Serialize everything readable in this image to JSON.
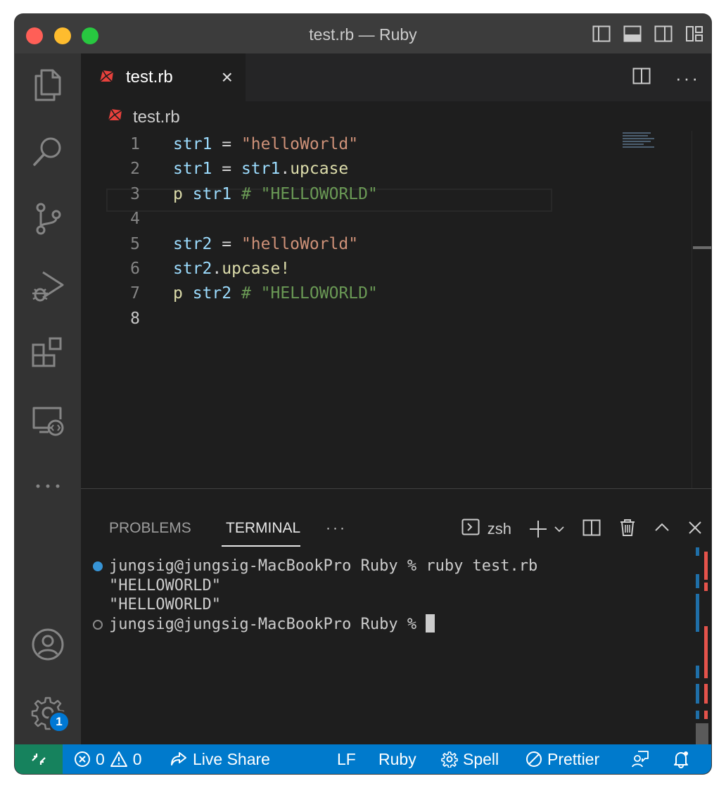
{
  "window": {
    "title": "test.rb — Ruby"
  },
  "activity_bar": {
    "icons": [
      "files-icon",
      "search-icon",
      "source-control-icon",
      "run-debug-icon",
      "extensions-icon",
      "remote-explorer-icon",
      "more-icon",
      "account-icon",
      "settings-gear-icon"
    ],
    "settings_badge": "1"
  },
  "editor": {
    "tab": {
      "label": "test.rb",
      "close": "×"
    },
    "more_actions": "···",
    "breadcrumb": "test.rb",
    "lines": [
      {
        "n": "1",
        "tokens": [
          [
            "v",
            "str1"
          ],
          [
            "o",
            " = "
          ],
          [
            "s",
            "\"helloWorld\""
          ]
        ]
      },
      {
        "n": "2",
        "tokens": [
          [
            "v",
            "str1"
          ],
          [
            "o",
            " = "
          ],
          [
            "v",
            "str1"
          ],
          [
            "o",
            "."
          ],
          [
            "f",
            "upcase"
          ]
        ]
      },
      {
        "n": "3",
        "tokens": [
          [
            "f",
            "p"
          ],
          [
            "o",
            " "
          ],
          [
            "v",
            "str1"
          ],
          [
            "o",
            " "
          ],
          [
            "c",
            "# \"HELLOWORLD\""
          ]
        ]
      },
      {
        "n": "4",
        "tokens": []
      },
      {
        "n": "5",
        "tokens": [
          [
            "v",
            "str2"
          ],
          [
            "o",
            " = "
          ],
          [
            "s",
            "\"helloWorld\""
          ]
        ]
      },
      {
        "n": "6",
        "tokens": [
          [
            "v",
            "str2"
          ],
          [
            "o",
            "."
          ],
          [
            "f",
            "upcase!"
          ]
        ]
      },
      {
        "n": "7",
        "tokens": [
          [
            "f",
            "p"
          ],
          [
            "o",
            " "
          ],
          [
            "v",
            "str2"
          ],
          [
            "o",
            " "
          ],
          [
            "c",
            "# \"HELLOWORLD\""
          ]
        ]
      },
      {
        "n": "8",
        "tokens": []
      }
    ],
    "active_line": "8"
  },
  "panel": {
    "tabs": [
      "PROBLEMS",
      "TERMINAL"
    ],
    "active_tab": "TERMINAL",
    "more": "···",
    "shell": "zsh",
    "terminal_lines": [
      {
        "dot": "filled",
        "text": "jungsig@jungsig-MacBookPro Ruby % ruby test.rb"
      },
      {
        "dot": "none",
        "text": "\"HELLOWORLD\""
      },
      {
        "dot": "none",
        "text": "\"HELLOWORLD\""
      },
      {
        "dot": "hollow",
        "text": "jungsig@jungsig-MacBookPro Ruby % ",
        "cursor": true
      }
    ]
  },
  "status_bar": {
    "errors": "0",
    "warnings": "0",
    "live_share": "Live Share",
    "eol": "LF",
    "language": "Ruby",
    "spell": "Spell",
    "prettier": "Prettier"
  },
  "colors": {
    "status_bar": "#007acc",
    "remote": "#16825d",
    "ruby_icon": "#e8413c"
  }
}
